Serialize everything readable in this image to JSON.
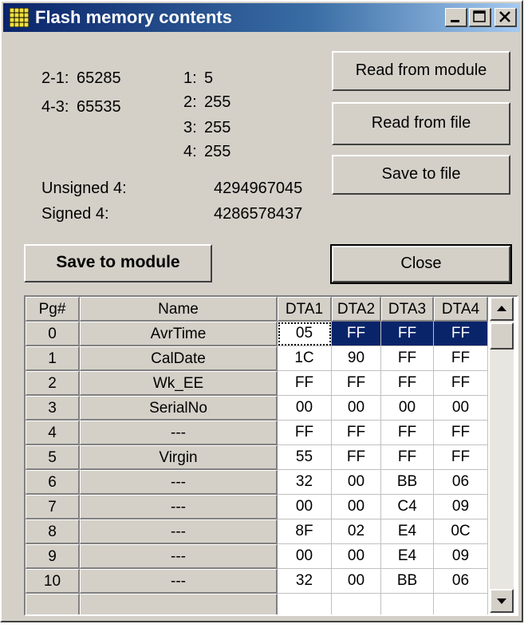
{
  "window": {
    "title": "Flash memory contents"
  },
  "info": {
    "left_rows": [
      {
        "key": "2-1:",
        "value": "65285"
      },
      {
        "key": "4-3:",
        "value": "65535"
      }
    ],
    "byte_rows": [
      {
        "key": "1:",
        "value": "5"
      },
      {
        "key": "2:",
        "value": "255"
      },
      {
        "key": "3:",
        "value": "255"
      },
      {
        "key": "4:",
        "value": "255"
      }
    ],
    "unsigned_label": "Unsigned 4:",
    "unsigned_value": "4294967045",
    "signed_label": "Signed 4:",
    "signed_value": "4286578437"
  },
  "buttons": {
    "read_module": "Read from module",
    "read_file": "Read from file",
    "save_file": "Save to file",
    "save_module": "Save to module",
    "close": "Close"
  },
  "table": {
    "headers": [
      "Pg#",
      "Name",
      "DTA1",
      "DTA2",
      "DTA3",
      "DTA4"
    ],
    "rows": [
      [
        "0",
        "AvrTime",
        "05",
        "FF",
        "FF",
        "FF"
      ],
      [
        "1",
        "CalDate",
        "1C",
        "90",
        "FF",
        "FF"
      ],
      [
        "2",
        "Wk_EE",
        "FF",
        "FF",
        "FF",
        "FF"
      ],
      [
        "3",
        "SerialNo",
        "00",
        "00",
        "00",
        "00"
      ],
      [
        "4",
        "---",
        "FF",
        "FF",
        "FF",
        "FF"
      ],
      [
        "5",
        "Virgin",
        "55",
        "FF",
        "FF",
        "FF"
      ],
      [
        "6",
        "---",
        "32",
        "00",
        "BB",
        "06"
      ],
      [
        "7",
        "---",
        "00",
        "00",
        "C4",
        "09"
      ],
      [
        "8",
        "---",
        "8F",
        "02",
        "E4",
        "0C"
      ],
      [
        "9",
        "---",
        "00",
        "00",
        "E4",
        "09"
      ],
      [
        "10",
        "---",
        "32",
        "00",
        "BB",
        "06"
      ]
    ],
    "selected_row": 0,
    "selection_color": "#0a246a"
  },
  "icons": {
    "app": "grid-app-icon",
    "minimize": "minimize-icon",
    "maximize": "maximize-icon",
    "close": "close-icon",
    "scroll_up": "scroll-up-icon",
    "scroll_down": "scroll-down-icon"
  }
}
